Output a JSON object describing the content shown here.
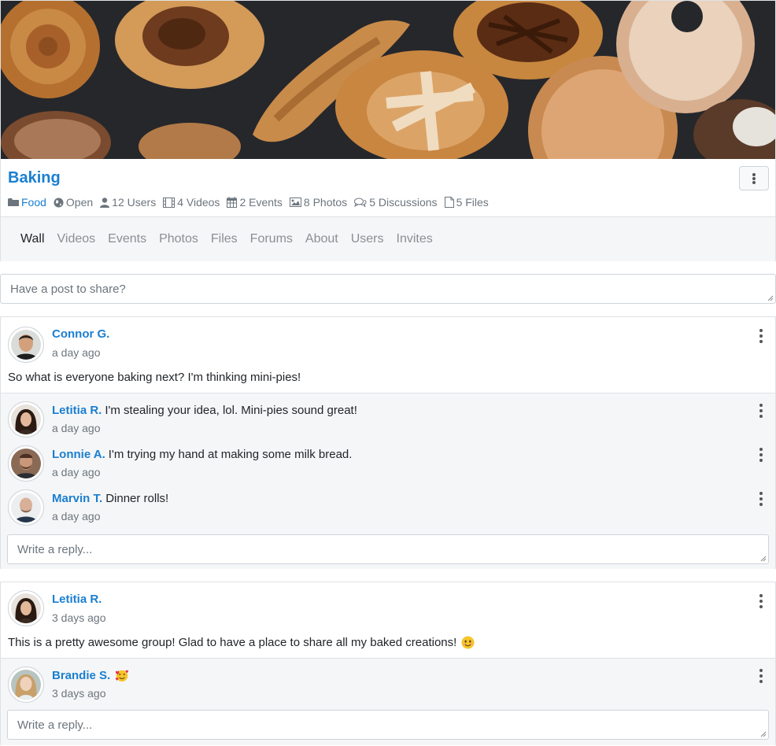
{
  "group": {
    "title": "Baking",
    "category": "Food",
    "privacy": "Open",
    "users": "12 Users",
    "videos": "4 Videos",
    "events": "2 Events",
    "photos": "8 Photos",
    "discussions": "5 Discussions",
    "files": "5 Files"
  },
  "tabs": [
    "Wall",
    "Videos",
    "Events",
    "Photos",
    "Files",
    "Forums",
    "About",
    "Users",
    "Invites"
  ],
  "composer": {
    "placeholder": "Have a post to share?"
  },
  "posts": [
    {
      "author": "Connor G.",
      "time": "a day ago",
      "text": "So what is everyone baking next? I'm thinking mini-pies!",
      "replies": [
        {
          "author": "Letitia R.",
          "text": "I'm stealing your idea, lol. Mini-pies sound great!",
          "time": "a day ago"
        },
        {
          "author": "Lonnie A.",
          "text": "I'm trying my hand at making some milk bread.",
          "time": "a day ago"
        },
        {
          "author": "Marvin T.",
          "text": "Dinner rolls!",
          "time": "a day ago"
        }
      ],
      "reply_placeholder": "Write a reply..."
    },
    {
      "author": "Letitia R.",
      "time": "3 days ago",
      "text": "This is a pretty awesome group! Glad to have a place to share all my baked creations!",
      "emoji": "smiling-face-emoji",
      "replies": [
        {
          "author": "Brandie S.",
          "text": "",
          "emoji": "smiling-face-with-hearts-emoji",
          "time": "3 days ago"
        }
      ],
      "reply_placeholder": "Write a reply..."
    }
  ],
  "colors": {
    "link": "#1a7fd0",
    "muted": "#6c757d",
    "tab_bg": "#f5f6f7",
    "reply_bg": "#f5f6f7"
  }
}
